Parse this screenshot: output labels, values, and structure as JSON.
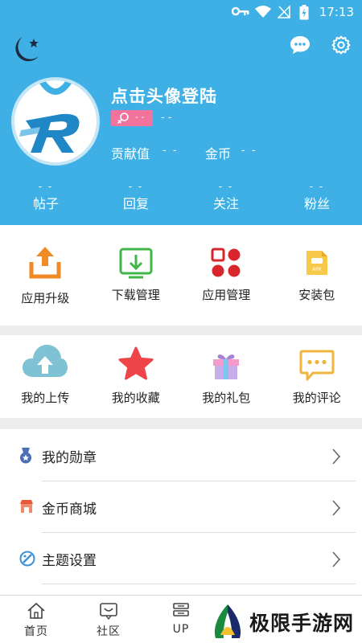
{
  "status_bar": {
    "time": "17:13"
  },
  "profile": {
    "login_text": "点击头像登陆",
    "level_value": "- -",
    "level_extra": "- -",
    "stats": [
      {
        "label": "贡献值",
        "value": "- -"
      },
      {
        "label": "金币",
        "value": "- -"
      }
    ],
    "counts": [
      {
        "label": "帖子",
        "value": "- -"
      },
      {
        "label": "回复",
        "value": "- -"
      },
      {
        "label": "关注",
        "value": "- -"
      },
      {
        "label": "粉丝",
        "value": "- -"
      }
    ]
  },
  "app_tools": [
    {
      "label": "应用升级",
      "icon": "upload-icon"
    },
    {
      "label": "下载管理",
      "icon": "download-icon"
    },
    {
      "label": "应用管理",
      "icon": "apps-icon"
    },
    {
      "label": "安装包",
      "icon": "apk-icon"
    }
  ],
  "my_items": [
    {
      "label": "我的上传",
      "icon": "cloud-upload-icon"
    },
    {
      "label": "我的收藏",
      "icon": "star-icon"
    },
    {
      "label": "我的礼包",
      "icon": "gift-icon"
    },
    {
      "label": "我的评论",
      "icon": "comment-icon"
    }
  ],
  "menu": [
    {
      "label": "我的勋章",
      "icon": "medal-icon"
    },
    {
      "label": "金币商城",
      "icon": "shop-icon"
    },
    {
      "label": "主题设置",
      "icon": "palette-icon"
    }
  ],
  "bottom_nav": [
    {
      "label": "首页",
      "icon": "home-icon"
    },
    {
      "label": "社区",
      "icon": "community-icon"
    },
    {
      "label": "UP",
      "icon": "up-icon"
    }
  ],
  "watermark": {
    "text": "极限手游网"
  },
  "colors": {
    "header_bg": "#3eb0e6",
    "separator": "#ececec",
    "badge": "#f2739b"
  }
}
